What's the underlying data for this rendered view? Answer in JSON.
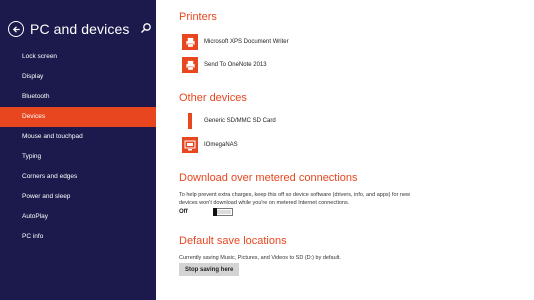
{
  "sidebar": {
    "title": "PC and devices",
    "items": [
      {
        "label": "Lock screen",
        "active": false
      },
      {
        "label": "Display",
        "active": false
      },
      {
        "label": "Bluetooth",
        "active": false
      },
      {
        "label": "Devices",
        "active": true
      },
      {
        "label": "Mouse and touchpad",
        "active": false
      },
      {
        "label": "Typing",
        "active": false
      },
      {
        "label": "Corners and edges",
        "active": false
      },
      {
        "label": "Power and sleep",
        "active": false
      },
      {
        "label": "AutoPlay",
        "active": false
      },
      {
        "label": "PC info",
        "active": false
      }
    ]
  },
  "printers": {
    "title": "Printers",
    "items": [
      {
        "label": "Microsoft XPS Document Writer",
        "icon": "printer-icon"
      },
      {
        "label": "Send To OneNote 2013",
        "icon": "printer-icon"
      }
    ]
  },
  "other_devices": {
    "title": "Other devices",
    "items": [
      {
        "label": "Generic SD/MMC SD Card",
        "icon": "sd-card-icon"
      },
      {
        "label": "IOmegaNAS",
        "icon": "nas-icon"
      }
    ]
  },
  "metered": {
    "title": "Download over metered connections",
    "description": "To help prevent extra charges, keep this off so device software (drivers, info, and apps) for new devices won't download while you're on metered Internet connections.",
    "toggle_label": "Off",
    "toggle_on": false
  },
  "save_locations": {
    "title": "Default save locations",
    "description": "Currently saving Music, Pictures, and Videos to SD (D:) by default.",
    "button_label": "Stop saving here"
  },
  "colors": {
    "accent": "#e8461f",
    "sidebar_bg": "#1c1a4c",
    "content_bg": "#ffffff"
  }
}
